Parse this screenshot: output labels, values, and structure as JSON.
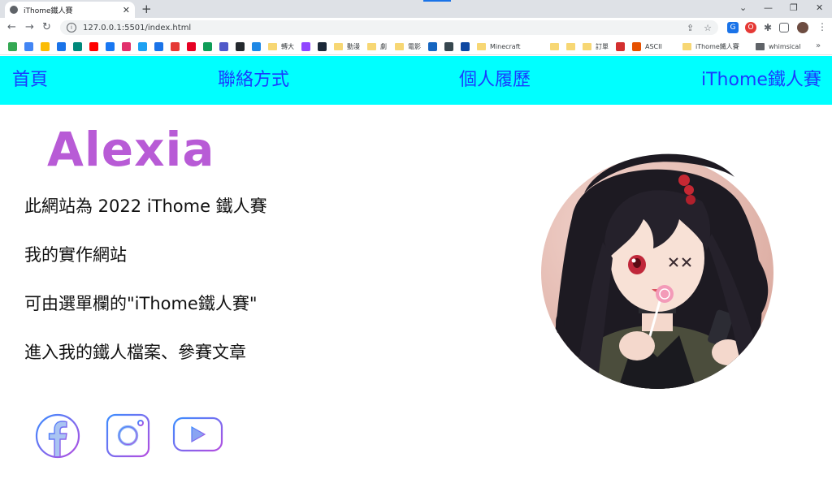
{
  "browser": {
    "tab_title": "iThome鐵人賽",
    "new_tab": "+",
    "tab_close": "✕",
    "url": "127.0.0.1:5501/index.html",
    "window_controls": [
      "⌄",
      "—",
      "❐",
      "✕"
    ]
  },
  "bookmarks": [
    {
      "label": "",
      "color": "#34a853"
    },
    {
      "label": "",
      "color": "#4285f4"
    },
    {
      "label": "",
      "color": "#fbbc05"
    },
    {
      "label": "",
      "color": "#1a73e8"
    },
    {
      "label": "",
      "color": "#00897b"
    },
    {
      "label": "",
      "color": "#ff0000"
    },
    {
      "label": "",
      "color": "#1877f2"
    },
    {
      "label": "",
      "color": "#e1306c"
    },
    {
      "label": "",
      "color": "#1da1f2"
    },
    {
      "label": "",
      "color": "#1a73e8"
    },
    {
      "label": "",
      "color": "#e53935"
    },
    {
      "label": "",
      "color": "#e60023"
    },
    {
      "label": "",
      "color": "#0f9d58"
    },
    {
      "label": "",
      "color": "#5059c9"
    },
    {
      "label": "",
      "color": "#24292e"
    },
    {
      "label": "",
      "color": "#1e88e5"
    },
    {
      "label": "轉大",
      "color": "folder"
    },
    {
      "label": "",
      "color": "#9146ff"
    },
    {
      "label": "",
      "color": "#1b2838"
    },
    {
      "label": "動漫",
      "color": "folder"
    },
    {
      "label": "劇",
      "color": "folder"
    },
    {
      "label": "電影",
      "color": "folder"
    },
    {
      "label": "",
      "color": "#1565c0"
    },
    {
      "label": "",
      "color": "#37474f"
    },
    {
      "label": "",
      "color": "#0d47a1"
    },
    {
      "label": "Minecraft",
      "color": "folder"
    },
    {
      "label": "",
      "color": "folder"
    },
    {
      "label": "",
      "color": "folder"
    },
    {
      "label": "訂單",
      "color": "folder"
    },
    {
      "label": "",
      "color": "#d32f2f"
    },
    {
      "label": "ASCII",
      "color": "#e65100"
    },
    {
      "label": "iThome鐵人賽",
      "color": "folder"
    },
    {
      "label": "whimsical",
      "color": "folder-dark"
    }
  ],
  "site": {
    "nav": [
      "首頁",
      "聯絡方式",
      "個人履歷",
      "iThome鐵人賽"
    ],
    "name": "Alexia",
    "intro": [
      "此網站為 2022 iThome 鐵人賽",
      "我的實作網站",
      "可由選單欄的\"iThome鐵人賽\"",
      "進入我的鐵人檔案、參賽文章"
    ],
    "social": [
      "facebook-icon",
      "instagram-icon",
      "youtube-icon"
    ],
    "colors": {
      "nav_bg": "#00ffff",
      "nav_link": "#1a3cff",
      "name": "#b85bd6",
      "social_gradient_start": "#3a8dff",
      "social_gradient_end": "#b44de0"
    }
  }
}
